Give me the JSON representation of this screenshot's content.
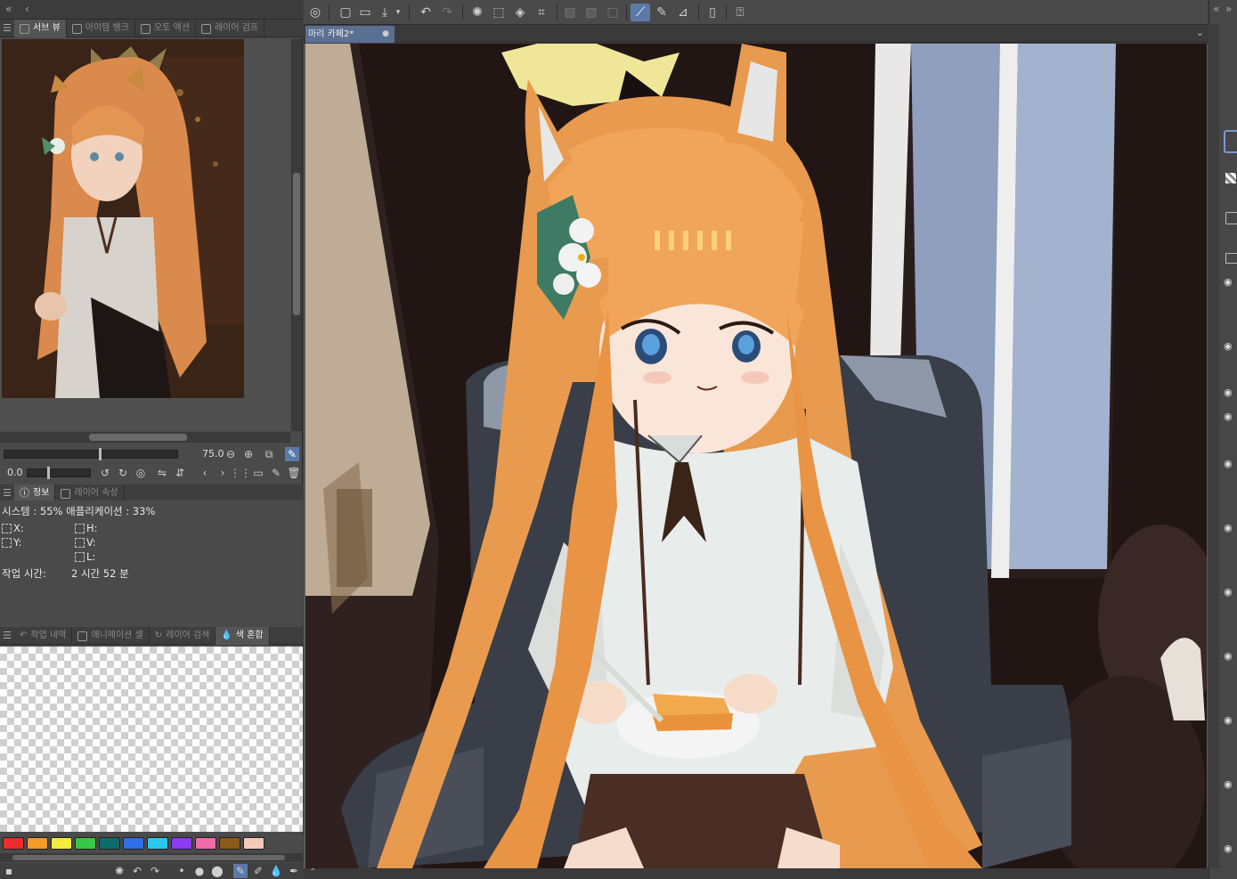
{
  "left_panel": {
    "collapse_icon": "double-chevron-left-icon",
    "back_icon": "chevron-left-icon",
    "top_tabs": [
      "서브 뷰",
      "아이템 뱅크",
      "오토 액션",
      "레이어 검프"
    ],
    "zoom_value": "75.0",
    "rotation_value": "0.0",
    "info_tabs": [
      "정보",
      "레이어 속성"
    ],
    "info": {
      "system_line": "시스템 : 55% 애플리케이션 : 33%",
      "x_label": "X:",
      "y_label": "Y:",
      "h_label": "H:",
      "v_label": "V:",
      "l_label": "L:",
      "work_time_label": "작업 시간:",
      "work_time_value": "2 시간 52 분"
    },
    "bottom_tabs": [
      "작업 내역",
      "애니메이션 셀",
      "레이어 검색",
      "색 혼합"
    ],
    "palette": [
      "#ee2b2b",
      "#f39a2b",
      "#f2ec3a",
      "#37c747",
      "#0e6b6b",
      "#2f6fe8",
      "#2ac8ee",
      "#8a3cf0",
      "#f06aa8",
      "#8a5a1a",
      "#f4c8b8"
    ]
  },
  "document": {
    "tab_title": "마리 카페2*",
    "close_icon": "dot-icon"
  },
  "colors": {
    "panel": "#4a4a4a",
    "dark": "#3a3a3a",
    "accent": "#5a6f92",
    "active_tool": "#5c7aa8"
  }
}
